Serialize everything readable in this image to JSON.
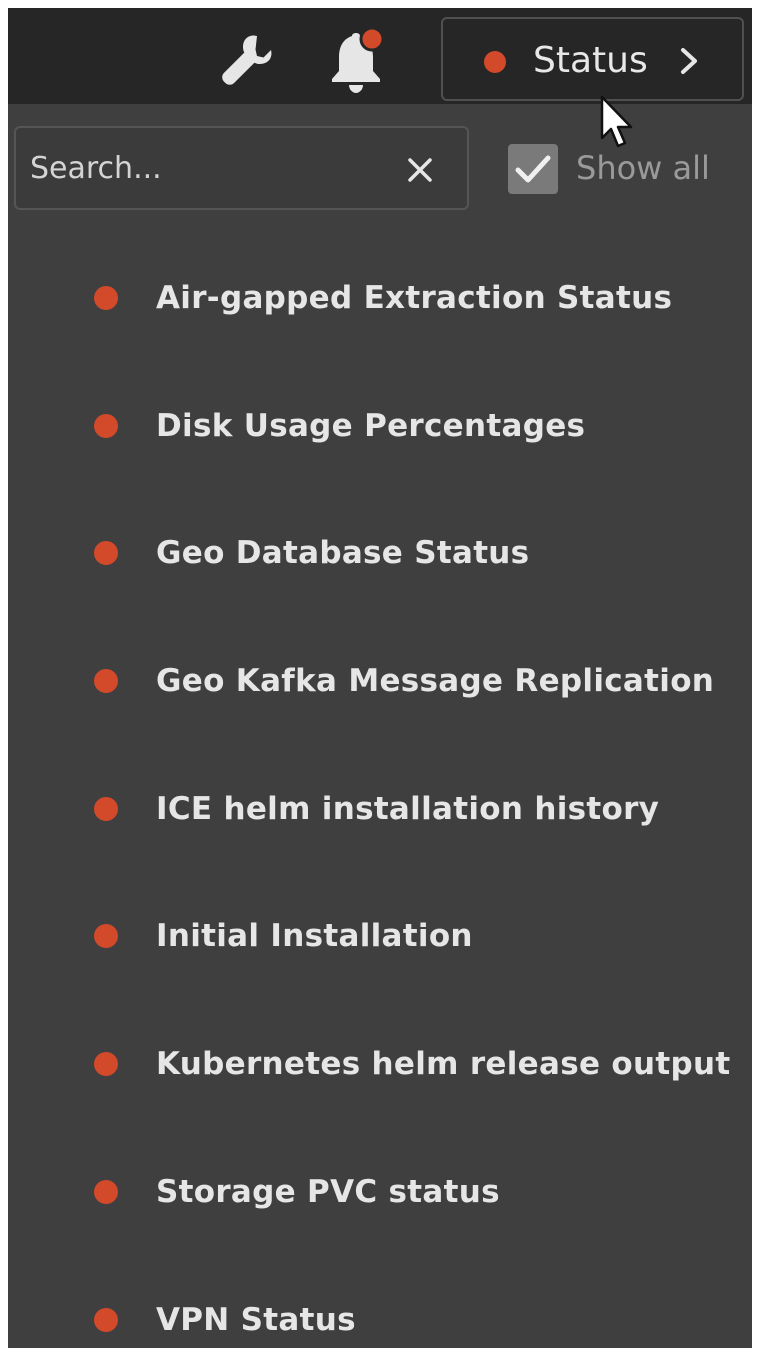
{
  "colors": {
    "status_dot": "#d24a29",
    "notification_dot": "#d24a29",
    "topbar_bg": "#262626",
    "panel_bg": "#3f3f3f"
  },
  "header": {
    "settings_icon": "wrench-icon",
    "notifications_icon": "bell-icon",
    "status_button": {
      "label": "Status",
      "indicator": "red",
      "chevron_icon": "chevron-right-icon"
    }
  },
  "filter": {
    "search": {
      "placeholder": "Search...",
      "value": ""
    },
    "clear_icon": "close-icon",
    "show_all": {
      "label": "Show all",
      "checked": true
    }
  },
  "status_items": [
    {
      "label": "Air-gapped Extraction Status",
      "indicator": "red"
    },
    {
      "label": "Disk Usage Percentages",
      "indicator": "red"
    },
    {
      "label": "Geo Database Status",
      "indicator": "red"
    },
    {
      "label": "Geo Kafka Message Replication",
      "indicator": "red"
    },
    {
      "label": "ICE helm installation history",
      "indicator": "red"
    },
    {
      "label": "Initial Installation",
      "indicator": "red"
    },
    {
      "label": "Kubernetes helm release output",
      "indicator": "red"
    },
    {
      "label": "Storage PVC status",
      "indicator": "red"
    },
    {
      "label": "VPN Status",
      "indicator": "red"
    }
  ]
}
